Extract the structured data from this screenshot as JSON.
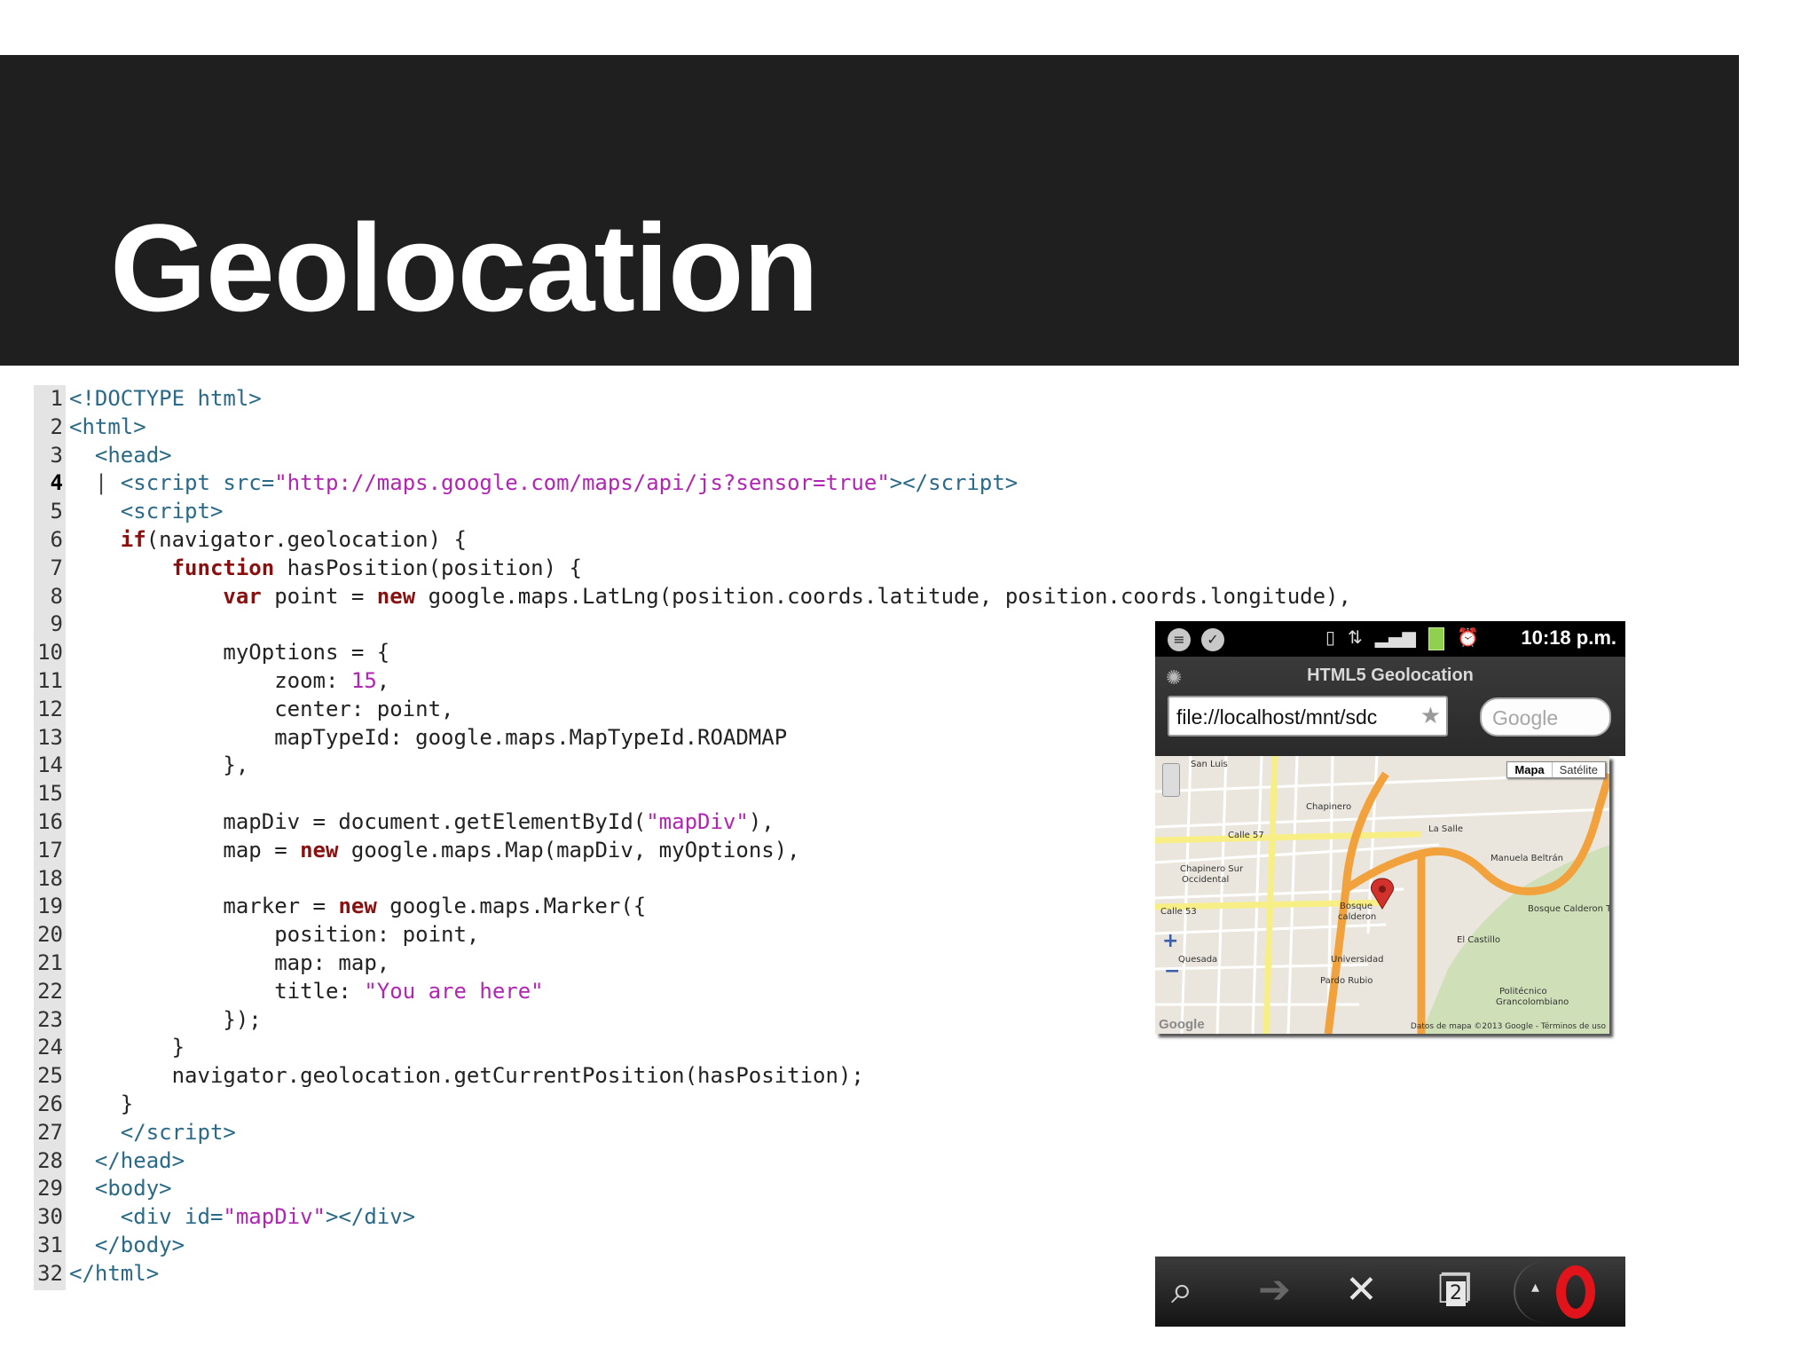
{
  "slide": {
    "title": "Geolocation"
  },
  "code": {
    "active_line": 4,
    "lines": [
      {
        "n": "1",
        "html": "<span class=\"tag\">&lt;!DOCTYPE html&gt;</span>"
      },
      {
        "n": "2",
        "html": "<span class=\"tag\">&lt;html&gt;</span>"
      },
      {
        "n": "3",
        "html": "  <span class=\"tag\">&lt;head&gt;</span>"
      },
      {
        "n": "4",
        "html": "<span class=\"caret\">  |</span> <span class=\"tag\">&lt;script src=</span><span class=\"str\">\"http://maps.google.com/maps/api/js?sensor=true\"</span><span class=\"tag\">&gt;&lt;/script&gt;</span>"
      },
      {
        "n": "5",
        "html": "    <span class=\"tag\">&lt;script&gt;</span>"
      },
      {
        "n": "6",
        "html": "    <span class=\"kw\">if</span>(navigator.geolocation) {"
      },
      {
        "n": "7",
        "html": "        <span class=\"kw\">function</span> hasPosition(position) {"
      },
      {
        "n": "8",
        "html": "            <span class=\"kw\">var</span> point = <span class=\"kw\">new</span> google.maps.LatLng(position.coords.latitude, position.coords.longitude),"
      },
      {
        "n": "9",
        "html": ""
      },
      {
        "n": "10",
        "html": "            myOptions = {"
      },
      {
        "n": "11",
        "html": "                zoom: <span class=\"num\">15</span>,"
      },
      {
        "n": "12",
        "html": "                center: point,"
      },
      {
        "n": "13",
        "html": "                mapTypeId: google.maps.MapTypeId.ROADMAP"
      },
      {
        "n": "14",
        "html": "            },"
      },
      {
        "n": "15",
        "html": ""
      },
      {
        "n": "16",
        "html": "            mapDiv = document.getElementById(<span class=\"str\">\"mapDiv\"</span>),"
      },
      {
        "n": "17",
        "html": "            map = <span class=\"kw\">new</span> google.maps.Map(mapDiv, myOptions),"
      },
      {
        "n": "18",
        "html": ""
      },
      {
        "n": "19",
        "html": "            marker = <span class=\"kw\">new</span> google.maps.Marker({"
      },
      {
        "n": "20",
        "html": "                position: point,"
      },
      {
        "n": "21",
        "html": "                map: map,"
      },
      {
        "n": "22",
        "html": "                title: <span class=\"str\">\"You are here\"</span>"
      },
      {
        "n": "23",
        "html": "            });"
      },
      {
        "n": "24",
        "html": "        }"
      },
      {
        "n": "25",
        "html": "        navigator.geolocation.getCurrentPosition(hasPosition);"
      },
      {
        "n": "26",
        "html": "    }"
      },
      {
        "n": "27",
        "html": "    <span class=\"tag\">&lt;/script&gt;</span>"
      },
      {
        "n": "28",
        "html": "  <span class=\"tag\">&lt;/head&gt;</span>"
      },
      {
        "n": "29",
        "html": "  <span class=\"tag\">&lt;body&gt;</span>"
      },
      {
        "n": "30",
        "html": "    <span class=\"tag\">&lt;div id=</span><span class=\"str\">\"mapDiv\"</span><span class=\"tag\">&gt;&lt;/div&gt;</span>"
      },
      {
        "n": "31",
        "html": "  <span class=\"tag\">&lt;/body&gt;</span>"
      },
      {
        "n": "32",
        "html": "<span class=\"tag\">&lt;/html&gt;</span>"
      }
    ]
  },
  "phone": {
    "status": {
      "time": "10:18 p.m.",
      "left_icons": [
        "chat-bubble-icon",
        "check-circle-icon"
      ],
      "right_icons": [
        "vibrate-icon",
        "hspa-data-icon",
        "signal-bars-icon",
        "battery-icon",
        "alarm-clock-icon"
      ],
      "battery_color": "#8fd14f"
    },
    "browser": {
      "app_title": "HTML5 Geolocation",
      "url": "file://localhost/mnt/sdc",
      "search_placeholder": "Google"
    },
    "map": {
      "type_buttons": [
        "Mapa",
        "Satélite"
      ],
      "selected_type": "Mapa",
      "labels": [
        "San Luis",
        "Chapinero",
        "La Salle",
        "Chapinero Sur",
        "Occidental",
        "Bosque",
        "calderon",
        "El Castillo",
        "Quesada",
        "Pardo Rubio",
        "Universidad",
        "Manuela Beltrán",
        "Bosque Calderon Tejada",
        "Politécnico",
        "Grancolombiano",
        "Calle 57",
        "Calle 53"
      ],
      "attribution": "Datos de mapa ©2013 Google - Términos de uso",
      "logo": "Google",
      "marker_color": "#d3322c",
      "road_color": "#f2a23c"
    },
    "toolbar": {
      "tabs_count": "2",
      "icons": [
        "search-back-icon",
        "forward-arrow-icon",
        "close-x-icon",
        "tabs-icon",
        "opera-menu-icon"
      ]
    }
  }
}
